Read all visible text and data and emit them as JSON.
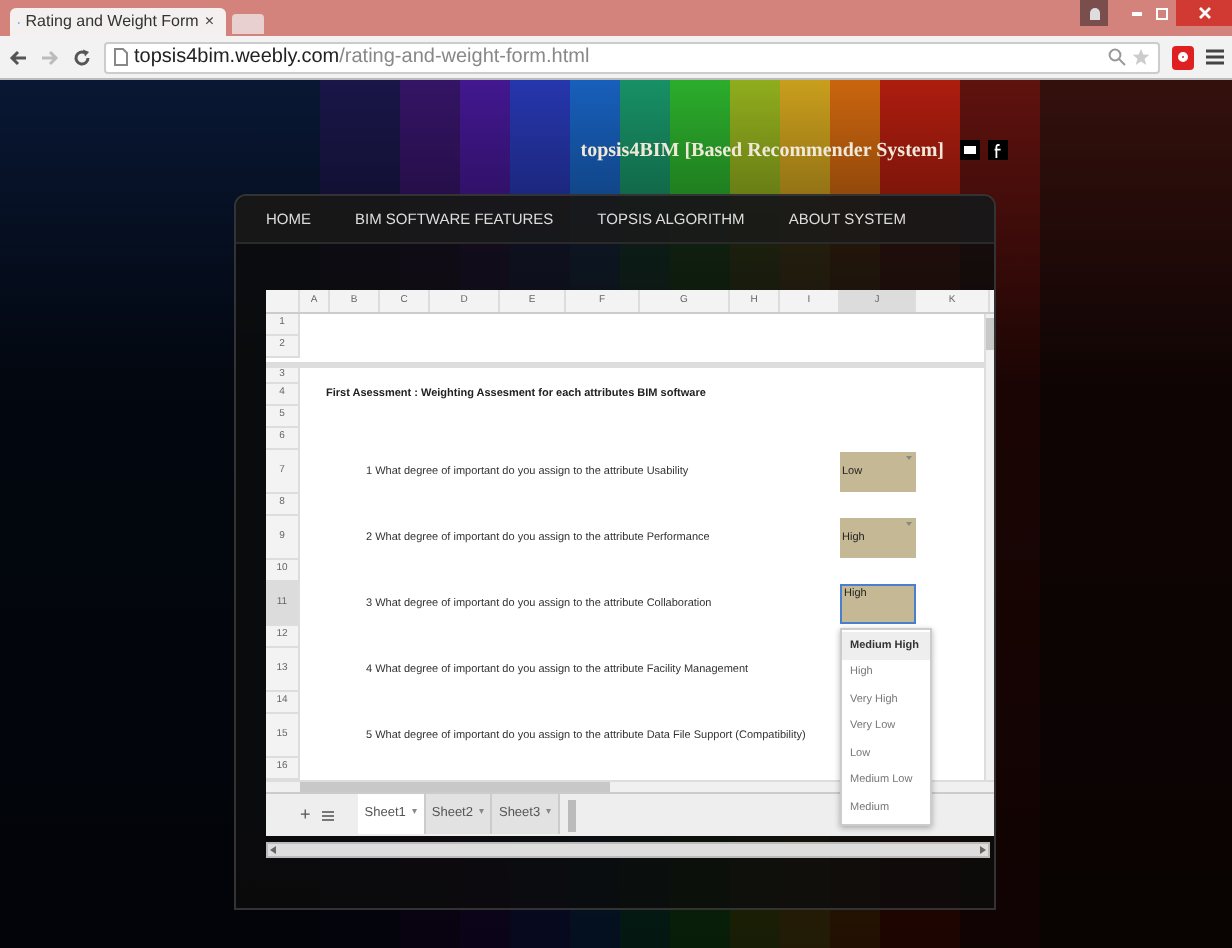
{
  "browser": {
    "tab_title": "Rating and Weight Form",
    "tab_close": "×",
    "url_host": "topsis4bim.weebly.com",
    "url_path": "/rating-and-weight-form.html"
  },
  "site": {
    "title": "topsis4BIM [Based Recommender System]",
    "nav": [
      {
        "label": "HOME"
      },
      {
        "label": "BIM SOFTWARE FEATURES"
      },
      {
        "label": "TOPSIS ALGORITHM"
      },
      {
        "label": "ABOUT SYSTEM"
      }
    ]
  },
  "sheet": {
    "columns": [
      {
        "label": "A",
        "selected": false
      },
      {
        "label": "B",
        "selected": false
      },
      {
        "label": "C",
        "selected": false
      },
      {
        "label": "D",
        "selected": false
      },
      {
        "label": "E",
        "selected": false
      },
      {
        "label": "F",
        "selected": false
      },
      {
        "label": "G",
        "selected": false
      },
      {
        "label": "H",
        "selected": false
      },
      {
        "label": "I",
        "selected": false
      },
      {
        "label": "J",
        "selected": true
      },
      {
        "label": "K",
        "selected": false
      }
    ],
    "rows": [
      {
        "number": "1",
        "kind": "blank"
      },
      {
        "number": "2",
        "kind": "blank"
      },
      {
        "number": "3",
        "kind": "blank"
      },
      {
        "number": "4",
        "kind": "heading",
        "text": "First Asessment : Weighting Assesment for each attributes BIM software"
      },
      {
        "number": "5",
        "kind": "blank"
      },
      {
        "number": "6",
        "kind": "blank"
      },
      {
        "number": "7",
        "kind": "question",
        "text": "1 What degree of important do you assign to the attribute Usability",
        "answer": "Low",
        "active": false
      },
      {
        "number": "8",
        "kind": "blank"
      },
      {
        "number": "9",
        "kind": "question",
        "text": "2 What degree of important do you assign to the attribute Performance",
        "answer": "High",
        "active": false
      },
      {
        "number": "10",
        "kind": "blank"
      },
      {
        "number": "11",
        "kind": "question",
        "text": "3 What degree of important do you assign to the attribute Collaboration",
        "answer": "High",
        "active": true
      },
      {
        "number": "12",
        "kind": "blank"
      },
      {
        "number": "13",
        "kind": "question",
        "text": "4 What degree of important do you assign to the attribute Facility Management"
      },
      {
        "number": "14",
        "kind": "blank"
      },
      {
        "number": "15",
        "kind": "question",
        "text": "5 What degree of important do you assign to the attribute Data File Support (Compatibility)"
      },
      {
        "number": "16",
        "kind": "blank"
      }
    ],
    "dropdown": {
      "options": [
        {
          "label": "Medium High",
          "selected": true
        },
        {
          "label": "High",
          "selected": false
        },
        {
          "label": "Very High",
          "selected": false
        },
        {
          "label": "Very Low",
          "selected": false
        },
        {
          "label": "Low",
          "selected": false
        },
        {
          "label": "Medium Low",
          "selected": false
        },
        {
          "label": "Medium",
          "selected": false
        }
      ]
    },
    "add_sheet": "+",
    "tabs": [
      {
        "label": "Sheet1",
        "caret": "▾",
        "selected": true
      },
      {
        "label": "Sheet2",
        "caret": "▾",
        "selected": false
      },
      {
        "label": "Sheet3",
        "caret": "▾",
        "selected": false
      }
    ]
  }
}
